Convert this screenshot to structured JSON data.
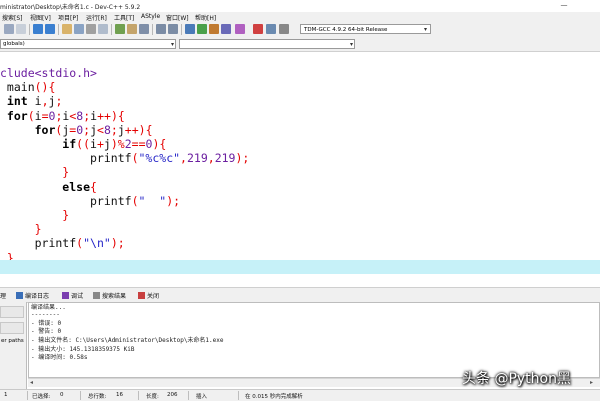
{
  "window": {
    "title": "ministrator\\Desktop\\未命名1.c - Dev-C++ 5.9.2",
    "minimize_glyph": "—"
  },
  "menu": [
    "搜索[S]",
    "视图[V]",
    "项目[P]",
    "运行[R]",
    "工具[T]",
    "AStyle",
    "窗口[W]",
    "帮助[H]"
  ],
  "toolbar": {
    "compiler": "TDM-GCC 4.9.2 64-bit Release"
  },
  "classbar": {
    "scope": "globals)"
  },
  "editor": {
    "lines": [
      {
        "segments": [
          {
            "t": "clude",
            "c": "pp"
          },
          {
            "t": "<stdio.h>",
            "c": "pp"
          }
        ]
      },
      {
        "segments": [
          {
            "t": " main",
            "c": "tx"
          },
          {
            "t": "()",
            "c": "sy"
          },
          {
            "t": "{",
            "c": "sy"
          }
        ]
      },
      {
        "segments": [
          {
            "t": " int",
            "c": "kw"
          },
          {
            "t": " i",
            "c": "tx"
          },
          {
            "t": ",",
            "c": "sy"
          },
          {
            "t": "j",
            "c": "tx"
          },
          {
            "t": ";",
            "c": "sy"
          }
        ]
      },
      {
        "segments": [
          {
            "t": " for",
            "c": "kw"
          },
          {
            "t": "(",
            "c": "sy"
          },
          {
            "t": "i",
            "c": "tx"
          },
          {
            "t": "=",
            "c": "sy"
          },
          {
            "t": "0",
            "c": "nm"
          },
          {
            "t": ";",
            "c": "sy"
          },
          {
            "t": "i",
            "c": "tx"
          },
          {
            "t": "<",
            "c": "sy"
          },
          {
            "t": "8",
            "c": "nm"
          },
          {
            "t": ";",
            "c": "sy"
          },
          {
            "t": "i",
            "c": "tx"
          },
          {
            "t": "++",
            "c": "sy"
          },
          {
            "t": ")",
            "c": "sy"
          },
          {
            "t": "{",
            "c": "sy"
          }
        ]
      },
      {
        "segments": [
          {
            "t": "     for",
            "c": "kw"
          },
          {
            "t": "(",
            "c": "sy"
          },
          {
            "t": "j",
            "c": "tx"
          },
          {
            "t": "=",
            "c": "sy"
          },
          {
            "t": "0",
            "c": "nm"
          },
          {
            "t": ";",
            "c": "sy"
          },
          {
            "t": "j",
            "c": "tx"
          },
          {
            "t": "<",
            "c": "sy"
          },
          {
            "t": "8",
            "c": "nm"
          },
          {
            "t": ";",
            "c": "sy"
          },
          {
            "t": "j",
            "c": "tx"
          },
          {
            "t": "++",
            "c": "sy"
          },
          {
            "t": ")",
            "c": "sy"
          },
          {
            "t": "{",
            "c": "sy"
          }
        ]
      },
      {
        "segments": [
          {
            "t": "         if",
            "c": "kw"
          },
          {
            "t": "((",
            "c": "sy"
          },
          {
            "t": "i",
            "c": "tx"
          },
          {
            "t": "+",
            "c": "sy"
          },
          {
            "t": "j",
            "c": "tx"
          },
          {
            "t": ")",
            "c": "sy"
          },
          {
            "t": "%",
            "c": "sy"
          },
          {
            "t": "2",
            "c": "nm"
          },
          {
            "t": "==",
            "c": "sy"
          },
          {
            "t": "0",
            "c": "nm"
          },
          {
            "t": ")",
            "c": "sy"
          },
          {
            "t": "{",
            "c": "sy"
          }
        ]
      },
      {
        "segments": [
          {
            "t": "             printf",
            "c": "tx"
          },
          {
            "t": "(",
            "c": "sy"
          },
          {
            "t": "\"%c%c\"",
            "c": "st"
          },
          {
            "t": ",",
            "c": "sy"
          },
          {
            "t": "219",
            "c": "nm"
          },
          {
            "t": ",",
            "c": "sy"
          },
          {
            "t": "219",
            "c": "nm"
          },
          {
            "t": ");",
            "c": "sy"
          }
        ]
      },
      {
        "segments": [
          {
            "t": "         }",
            "c": "sy"
          }
        ]
      },
      {
        "segments": [
          {
            "t": "         else",
            "c": "kw"
          },
          {
            "t": "{",
            "c": "sy"
          }
        ]
      },
      {
        "segments": [
          {
            "t": "             printf",
            "c": "tx"
          },
          {
            "t": "(",
            "c": "sy"
          },
          {
            "t": "\"  \"",
            "c": "st"
          },
          {
            "t": ");",
            "c": "sy"
          }
        ]
      },
      {
        "segments": [
          {
            "t": "         }",
            "c": "sy"
          }
        ]
      },
      {
        "segments": [
          {
            "t": "     }",
            "c": "sy"
          }
        ]
      },
      {
        "segments": [
          {
            "t": "     printf",
            "c": "tx"
          },
          {
            "t": "(",
            "c": "sy"
          },
          {
            "t": "\"\\n\"",
            "c": "st"
          },
          {
            "t": ");",
            "c": "sy"
          }
        ]
      },
      {
        "segments": [
          {
            "t": " }",
            "c": "sy"
          }
        ]
      }
    ]
  },
  "bottom_tabs": [
    {
      "label": "理",
      "icon": "compiler-icon"
    },
    {
      "label": "编译日志",
      "icon": "compile-log-icon"
    },
    {
      "label": "调试",
      "icon": "debug-check-icon"
    },
    {
      "label": "搜索结果",
      "icon": "search-results-icon"
    },
    {
      "label": "关闭",
      "icon": "close-icon"
    }
  ],
  "left_panel": {
    "label": "er paths"
  },
  "output": {
    "lines": [
      "编译结果...",
      "--------",
      "- 错误: 0",
      "- 警告: 0",
      "- 输出文件名: C:\\Users\\Administrator\\Desktop\\未命名1.exe",
      "- 输出大小: 145.1318359375 KiB",
      "- 编译时间: 0.58s"
    ]
  },
  "status": {
    "row": "1",
    "selected_label": "已选择:",
    "selected": "0",
    "total_label": "总行数:",
    "total": "16",
    "length_label": "长度:",
    "length": "206",
    "mode": "插入",
    "parse": "在 0.015 秒内完成解析"
  },
  "watermark": "头条 @Python黑",
  "colors": {
    "keyword": "#000000",
    "symbol": "#e40000",
    "string": "#2626c8",
    "preprocessor": "#6b1fa0",
    "current_line": "#c6f1f8"
  }
}
